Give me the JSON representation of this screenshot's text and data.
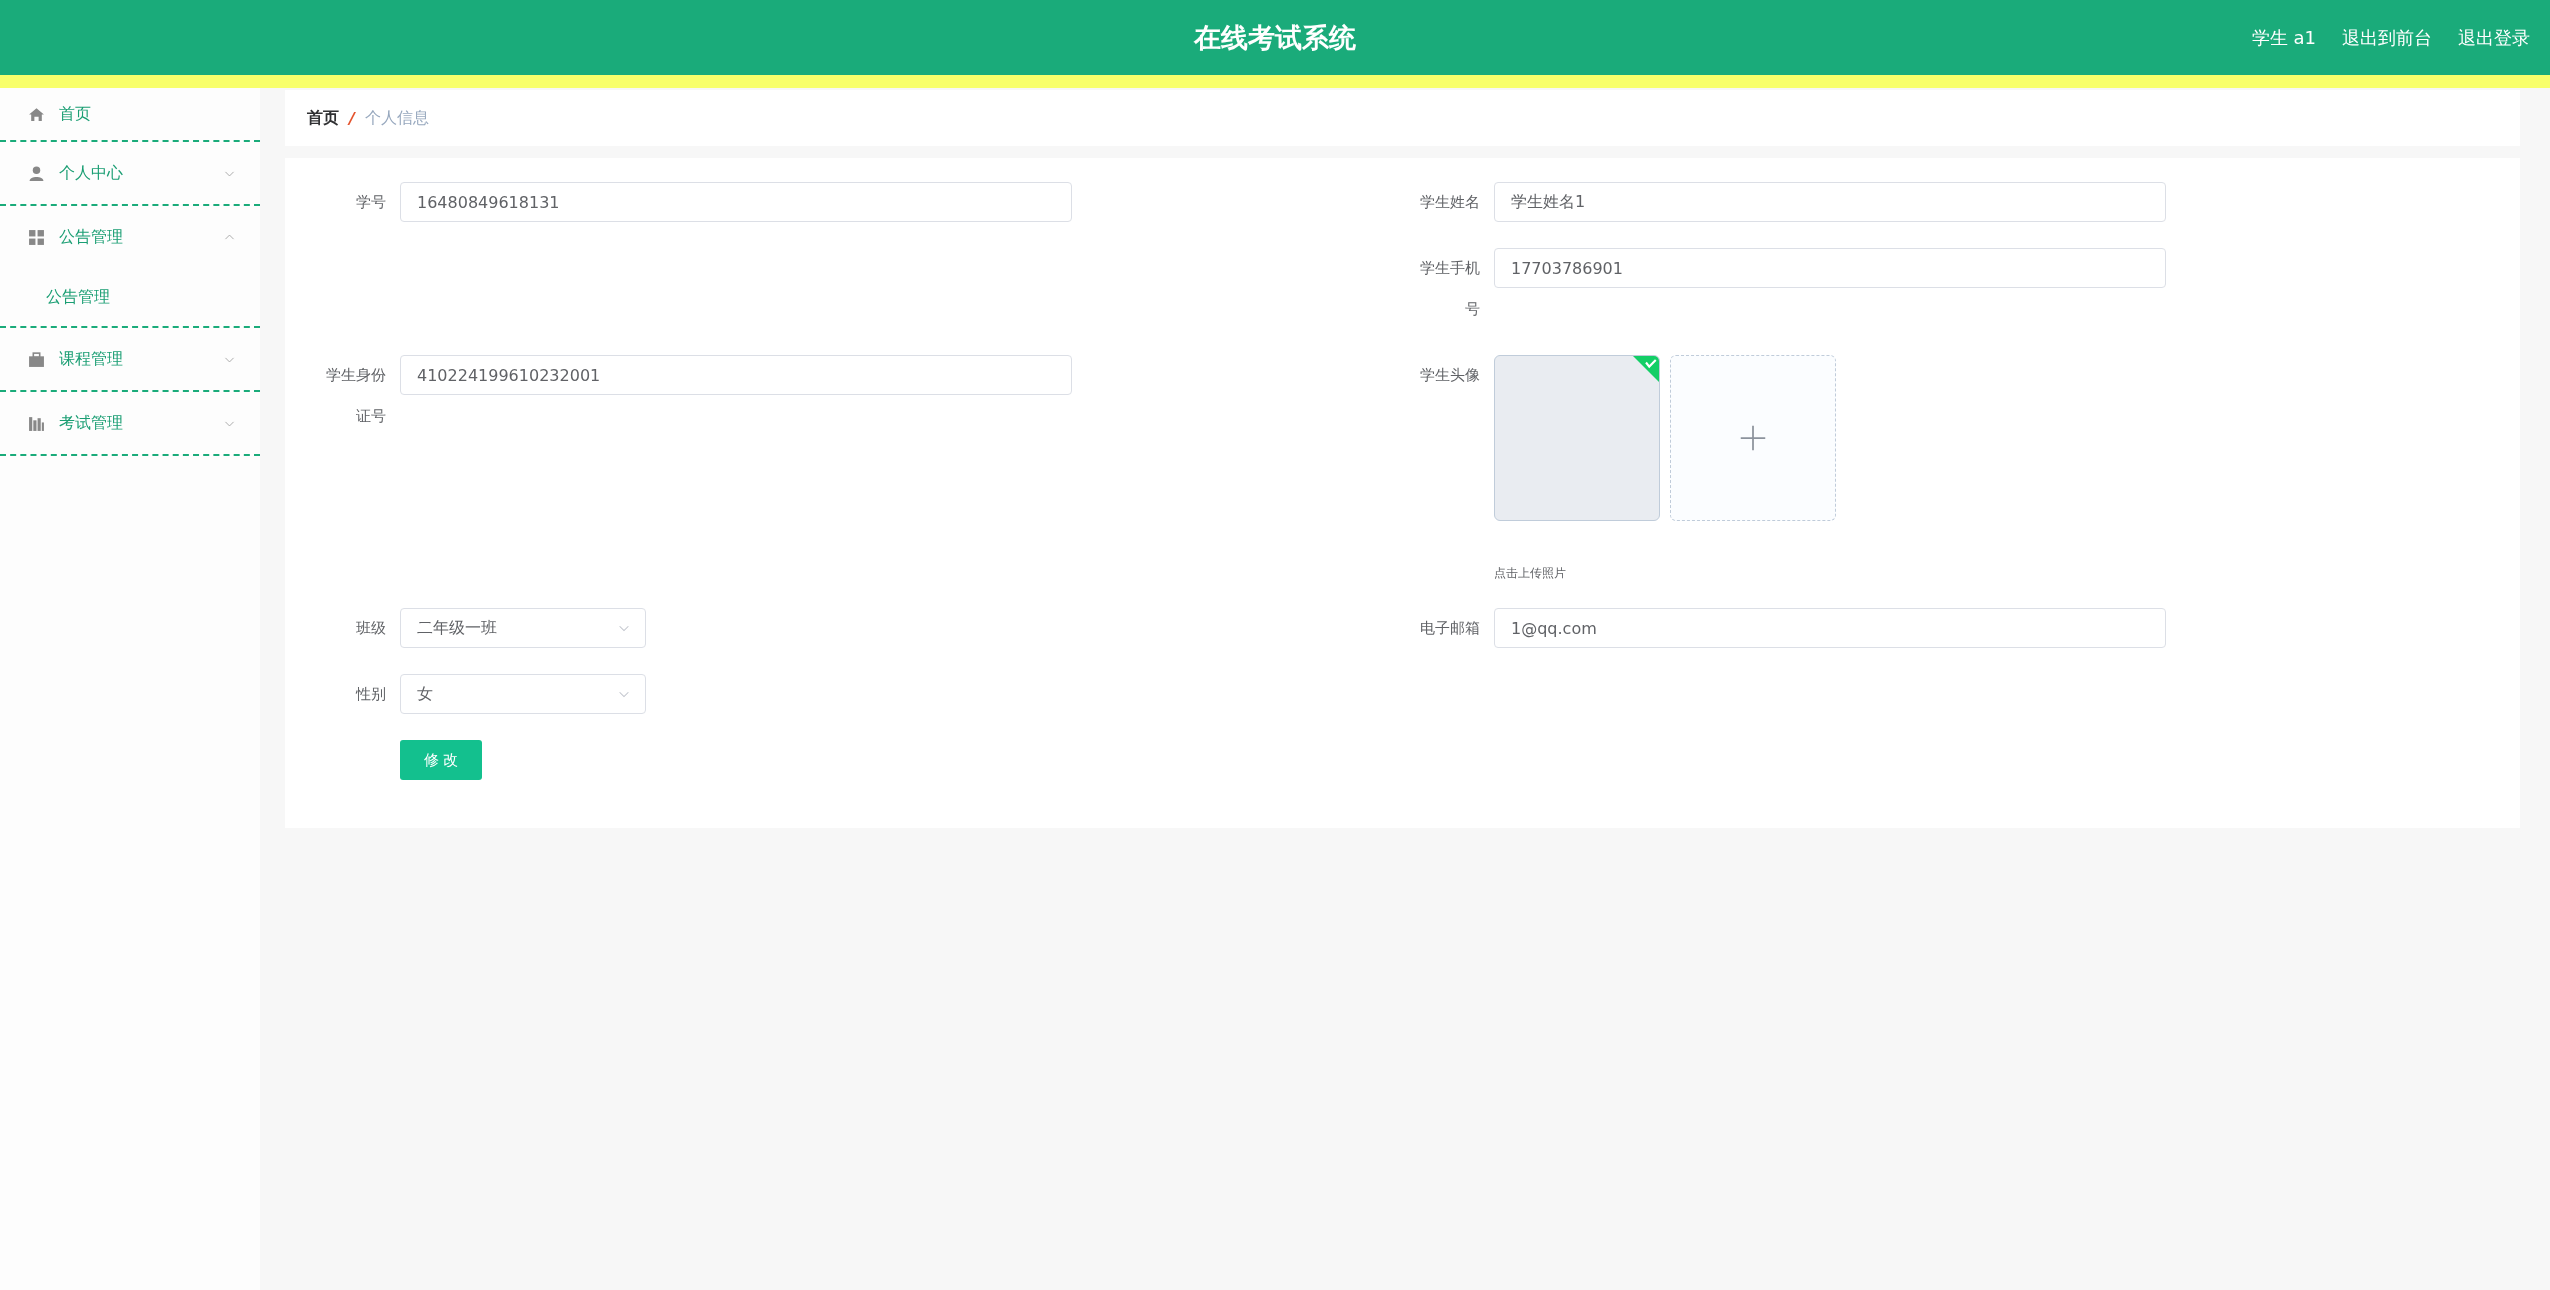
{
  "header": {
    "title": "在线考试系统",
    "links": [
      "学生 a1",
      "退出到前台",
      "退出登录"
    ]
  },
  "sidebar": {
    "items": [
      {
        "label": "首页"
      },
      {
        "label": "个人中心",
        "expanded": false
      },
      {
        "label": "公告管理",
        "expanded": true,
        "children": [
          {
            "label": "公告管理"
          }
        ]
      },
      {
        "label": "课程管理",
        "expanded": false
      },
      {
        "label": "考试管理",
        "expanded": false
      }
    ]
  },
  "breadcrumb": [
    "首页",
    "/",
    "个人信息"
  ],
  "form": {
    "student_id": {
      "label": "学号",
      "value": "16480849618131"
    },
    "name": {
      "label": "学生姓名",
      "value": "学生姓名1"
    },
    "phone": {
      "label": "学生手机号",
      "value": "17703786901"
    },
    "id_card": {
      "label": "学生身份证号",
      "value": "410224199610232001"
    },
    "avatar": {
      "label": "学生头像",
      "uploaded": true,
      "hint": "点击上传照片"
    },
    "class": {
      "label": "班级",
      "value": "二年级一班"
    },
    "email": {
      "label": "电子邮箱",
      "value": "1@qq.com"
    },
    "gender": {
      "label": "性别",
      "value": "女"
    },
    "submit": "修 改"
  }
}
